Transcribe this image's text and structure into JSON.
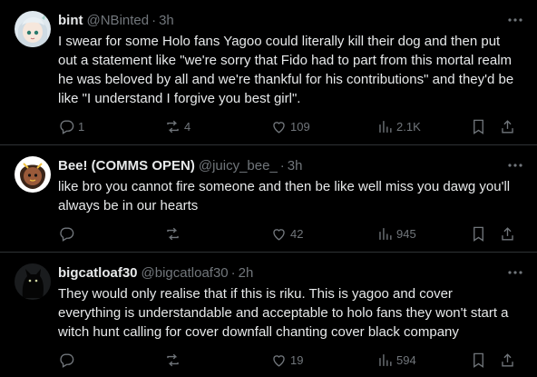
{
  "tweets": [
    {
      "name": "bint",
      "handle": "@NBinted",
      "time": "3h",
      "text": "I swear for some Holo fans Yagoo could literally kill their dog and then put out a statement like \"we're sorry that Fido had to part from this mortal realm he was beloved by all and we're thankful for his contributions\" and they'd be like \"I understand I forgive you best girl\".",
      "replies": "1",
      "reposts": "4",
      "likes": "109",
      "views": "2.1K"
    },
    {
      "name": "Bee! (COMMS OPEN)",
      "handle": "@juicy_bee_",
      "time": "3h",
      "text": "like bro you cannot fire someone and then be like well miss you dawg you'll always be in our hearts",
      "replies": "",
      "reposts": "",
      "likes": "42",
      "views": "945"
    },
    {
      "name": "bigcatloaf30",
      "handle": "@bigcatloaf30",
      "time": "2h",
      "text": "They would only realise that if this is riku. This is yagoo and cover everything is understandable and acceptable to holo fans they won't start a witch hunt calling for cover downfall chanting cover black company",
      "replies": "",
      "reposts": "",
      "likes": "19",
      "views": "594"
    }
  ],
  "icons": {
    "reply": "reply-icon",
    "repost": "repost-icon",
    "like": "heart-icon",
    "views": "views-icon",
    "bookmark": "bookmark-icon",
    "share": "share-icon",
    "more": "more-icon"
  },
  "colors": {
    "background": "#000000",
    "text": "#e7e9ea",
    "muted": "#71767b",
    "border": "#2f3336"
  }
}
